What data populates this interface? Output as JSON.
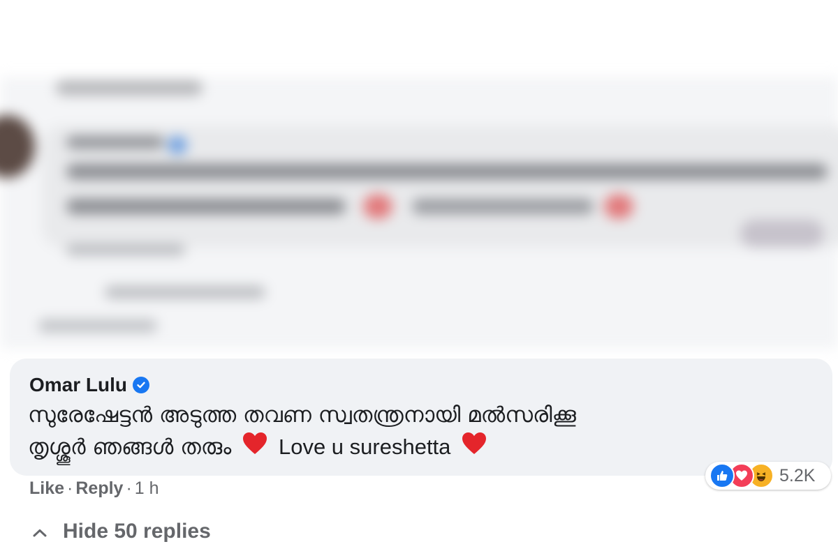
{
  "comment": {
    "author": "Omar Lulu",
    "verified_icon": "verified-badge-icon",
    "text_line1": "സുരേഷേട്ടൻ അടുത്ത തവണ സ്വതന്ത്രനായി മൽസരിക്കൂ",
    "text_line2_malayalam": "തൃശ്ശൂർ ഞങ്ങൾ തരും",
    "text_line2_english": "Love u sureshetta",
    "heart_emoji": "♥",
    "reaction_count": "5.2K",
    "reaction_icons": [
      "like-icon",
      "love-icon",
      "haha-icon"
    ],
    "actions": {
      "like": "Like",
      "dot1": "·",
      "reply": "Reply",
      "dot2": "·",
      "time": "1 h"
    }
  },
  "replies": {
    "hide_label": "Hide 50 replies",
    "chevron_icon": "chevron-up-icon"
  },
  "colors": {
    "bubble": "#f0f2f5",
    "verified": "#1877f2",
    "secondary_text": "#65676b",
    "heart": "#e4252b"
  }
}
